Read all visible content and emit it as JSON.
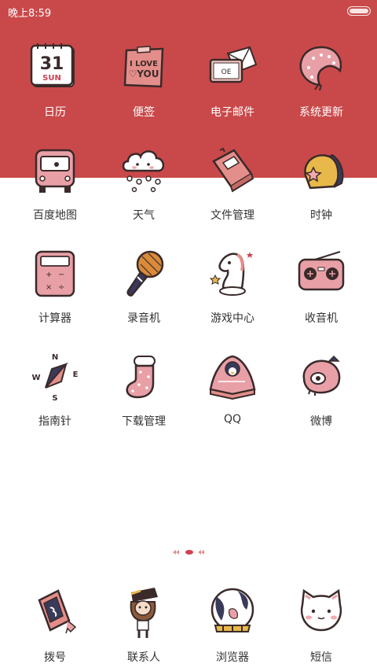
{
  "status_bar": {
    "time": "晚上8:59"
  },
  "apps": {
    "calendar": {
      "label": "日历",
      "icon_text": "31",
      "icon_subtext": "SUN"
    },
    "notes": {
      "label": "便签",
      "icon_text": "I LOVE YOU"
    },
    "email": {
      "label": "电子邮件"
    },
    "update": {
      "label": "系统更新"
    },
    "maps": {
      "label": "百度地图"
    },
    "weather": {
      "label": "天气"
    },
    "files": {
      "label": "文件管理"
    },
    "clock": {
      "label": "时钟"
    },
    "calculator": {
      "label": "计算器"
    },
    "recorder": {
      "label": "录音机"
    },
    "game_center": {
      "label": "游戏中心"
    },
    "radio": {
      "label": "收音机"
    },
    "compass": {
      "label": "指南针",
      "dir_n": "N",
      "dir_w": "W",
      "dir_e": "E",
      "dir_s": "S"
    },
    "downloads": {
      "label": "下载管理"
    },
    "qq": {
      "label": "QQ"
    },
    "weibo": {
      "label": "微博"
    }
  },
  "dock": {
    "dialer": {
      "label": "拨号"
    },
    "contacts": {
      "label": "联系人"
    },
    "browser": {
      "label": "浏览器"
    },
    "sms": {
      "label": "短信"
    }
  },
  "colors": {
    "header_bg": "#c9494a",
    "icon_fill": "#e8a0a6",
    "icon_stroke": "#3a2a2a",
    "label_dark": "#333333",
    "label_light": "#ffffff"
  },
  "icons": {
    "calendar": "calendar-icon",
    "notes": "notes-icon",
    "email": "envelope-icon",
    "update": "update-icon",
    "maps": "bus-icon",
    "weather": "cloud-icon",
    "files": "folder-icon",
    "clock": "alarm-icon",
    "calculator": "calculator-icon",
    "recorder": "microphone-icon",
    "game_center": "chess-knight-icon",
    "radio": "radio-icon",
    "compass": "compass-icon",
    "downloads": "stocking-icon",
    "qq": "penguin-icon",
    "weibo": "weibo-icon",
    "dialer": "phone-icon",
    "contacts": "girl-avatar-icon",
    "browser": "globe-icon",
    "sms": "cat-icon"
  }
}
